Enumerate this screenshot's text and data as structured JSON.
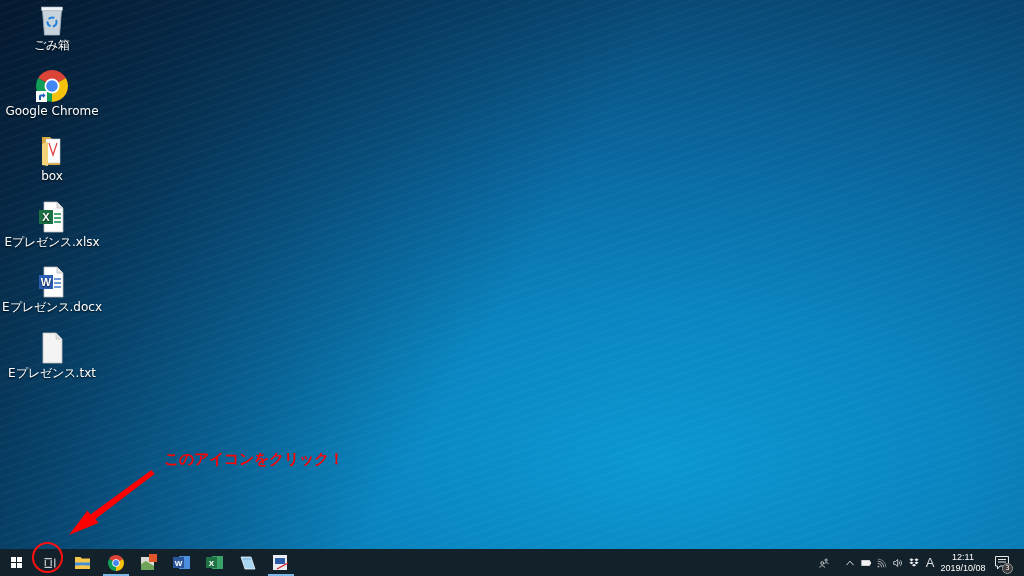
{
  "desktop": {
    "icons": [
      {
        "kind": "recycle-bin",
        "label": "ごみ箱",
        "shortcut": false
      },
      {
        "kind": "chrome",
        "label": "Google Chrome",
        "shortcut": true
      },
      {
        "kind": "folder",
        "label": "box",
        "shortcut": false
      },
      {
        "kind": "excel-file",
        "label": "Eプレゼンス.xlsx",
        "glyph": "X",
        "shortcut": false
      },
      {
        "kind": "word-file",
        "label": "Eプレゼンス.docx",
        "glyph": "W",
        "shortcut": false
      },
      {
        "kind": "text-file",
        "label": "Eプレゼンス.txt",
        "shortcut": false
      }
    ]
  },
  "annotation": {
    "text": "このアイコンをクリック！"
  },
  "taskbar": {
    "buttons": [
      {
        "kind": "start",
        "running": false,
        "circled": false
      },
      {
        "kind": "task-view",
        "running": false,
        "circled": true
      },
      {
        "kind": "explorer",
        "running": false,
        "circled": false
      },
      {
        "kind": "chrome",
        "running": true,
        "circled": false
      },
      {
        "kind": "picture-app",
        "running": false,
        "circled": false
      },
      {
        "kind": "word",
        "glyph": "W",
        "running": false,
        "circled": false
      },
      {
        "kind": "excel",
        "glyph": "X",
        "running": false,
        "circled": false
      },
      {
        "kind": "notebook",
        "running": false,
        "circled": false
      },
      {
        "kind": "window-app",
        "running": true,
        "circled": false
      }
    ],
    "tray": {
      "icons": [
        {
          "kind": "people"
        },
        {
          "kind": "chevron"
        },
        {
          "kind": "battery"
        },
        {
          "kind": "wifi"
        },
        {
          "kind": "volume"
        },
        {
          "kind": "dropbox"
        }
      ],
      "ime": "A",
      "time": "12:11",
      "date": "2019/10/08",
      "notifications": {
        "count": "3"
      }
    }
  }
}
